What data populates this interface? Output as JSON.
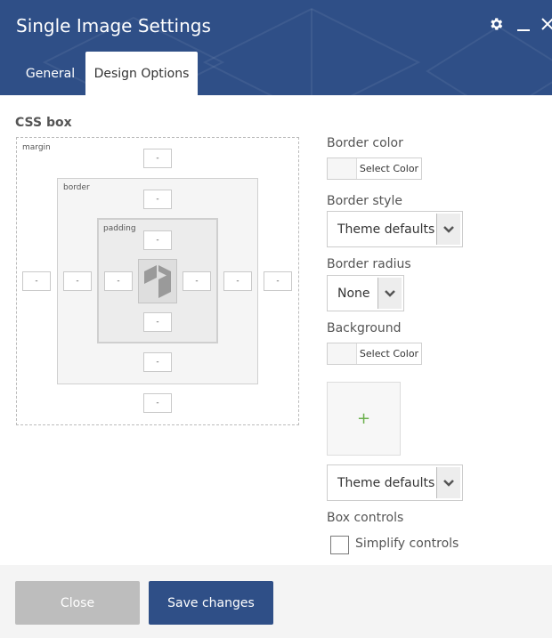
{
  "window": {
    "title": "Single Image Settings",
    "icons": [
      "gear-icon",
      "minimize-icon",
      "close-icon"
    ]
  },
  "tabs": [
    {
      "label": "General",
      "active": false
    },
    {
      "label": "Design Options",
      "active": true
    }
  ],
  "css_box": {
    "title": "CSS box",
    "margin_label": "margin",
    "border_label": "border",
    "padding_label": "padding",
    "placeholder": "-"
  },
  "fields": {
    "border_color_label": "Border color",
    "border_color_button": "Select Color",
    "border_style_label": "Border style",
    "border_style_value": "Theme defaults",
    "border_radius_label": "Border radius",
    "border_radius_value": "None",
    "background_label": "Background",
    "background_button": "Select Color",
    "image_add": "+",
    "background_style_value": "Theme defaults",
    "box_controls_label": "Box controls",
    "simplify_label": "Simplify controls",
    "simplify_checked": false
  },
  "footer": {
    "close_label": "Close",
    "save_label": "Save changes"
  },
  "colors": {
    "header": "#2f4f87",
    "save_button": "#2f4f87",
    "close_button": "#bdbdbd",
    "add_icon": "#6ab04c"
  }
}
